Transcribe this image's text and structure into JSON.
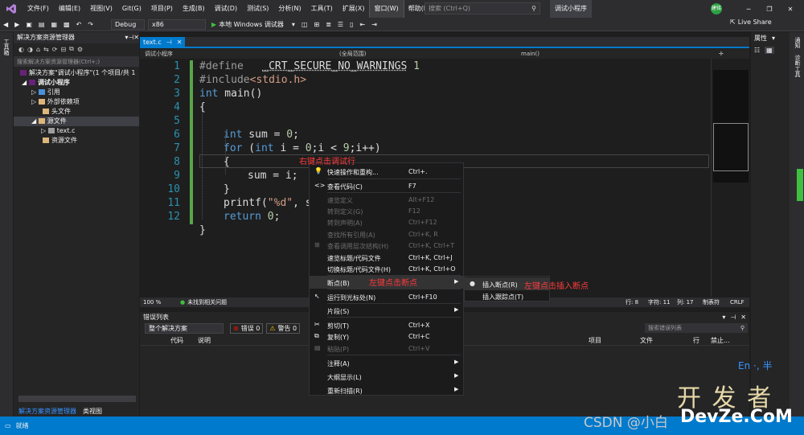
{
  "menu": {
    "items": [
      "文件(F)",
      "编辑(E)",
      "视图(V)",
      "Git(G)",
      "项目(P)",
      "生成(B)",
      "调试(D)",
      "测试(S)",
      "分析(N)",
      "工具(T)",
      "扩展(X)",
      "窗口(W)",
      "帮助(H)"
    ],
    "search_placeholder": "搜索 (Ctrl+Q)",
    "project_title": "调试小程序",
    "avatar_initials": "建铭",
    "live_share": "Live Share"
  },
  "toolbar": {
    "config": "Debug",
    "platform": "x86",
    "run_label": "本地 Windows 调试器"
  },
  "solution_explorer": {
    "title": "解决方案资源管理器",
    "search_placeholder": "搜索解决方案资源管理器(Ctrl+;)",
    "items": [
      {
        "label": "解决方案\"调试小程序\"(1 个项目/共 1"
      },
      {
        "label": "调试小程序"
      },
      {
        "label": "引用"
      },
      {
        "label": "外部依赖项"
      },
      {
        "label": "头文件"
      },
      {
        "label": "源文件"
      },
      {
        "label": "text.c"
      },
      {
        "label": "资源文件"
      }
    ],
    "bottom_tabs": [
      "解决方案资源管理器",
      "类视图"
    ]
  },
  "left_strip": {
    "toolbox": "工具箱"
  },
  "editor": {
    "tab": "text.c",
    "nav_project": "调试小程序",
    "nav_scope": "(全局范围)",
    "nav_member": "main()",
    "zoom": "100 %",
    "no_issues": "未找到相关问题",
    "pos_line": "行: 8",
    "pos_char": "字符: 11",
    "pos_col": "列: 17",
    "pos_tab": "制表符",
    "pos_eol": "CRLF",
    "annotation": "右键点击调试行",
    "line_numbers": [
      "1",
      "2",
      "3",
      "4",
      "5",
      "6",
      "7",
      "8",
      "9",
      "10",
      "11",
      "12"
    ],
    "lines": {
      "l1a": "#define",
      "l1b": "_CRT_SECURE_NO_WARNINGS",
      "l1c": "1",
      "l2a": "#include",
      "l2b": "<stdio.h>",
      "l3a": "int",
      "l3b": " main()",
      "l4": "{",
      "l6a": "int",
      "l6b": " sum = ",
      "l6c": "0",
      "l6d": ";",
      "l7a": "for",
      "l7b": " (",
      "l7c": "int",
      "l7d": " i = ",
      "l7e": "0",
      "l7f": ";i < ",
      "l7g": "9",
      "l7h": ";i++)",
      "l8": "{",
      "l9": "sum = i;",
      "l10": "}",
      "l11a": "printf(",
      "l11b": "\"%d\"",
      "l11c": ", su",
      "l12a": "return",
      "l12b": " ",
      "l12c": "0",
      "l12d": ";",
      "l13": "}"
    }
  },
  "context_menu": {
    "items": [
      {
        "label": "快速操作和重构...",
        "shortcut": "Ctrl+."
      },
      {
        "label": "查看代码(C)",
        "shortcut": "F7"
      },
      {
        "label": "速览定义",
        "shortcut": "Alt+F12"
      },
      {
        "label": "转到定义(G)",
        "shortcut": "F12"
      },
      {
        "label": "转到声明(A)",
        "shortcut": "Ctrl+F12"
      },
      {
        "label": "查找所有引用(A)",
        "shortcut": "Ctrl+K, R"
      },
      {
        "label": "查看调用层次结构(H)",
        "shortcut": "Ctrl+K, Ctrl+T"
      },
      {
        "label": "速览标题/代码文件",
        "shortcut": "Ctrl+K, Ctrl+J"
      },
      {
        "label": "切换标题/代码文件(H)",
        "shortcut": "Ctrl+K, Ctrl+O"
      },
      {
        "label": "断点(B)",
        "shortcut": ""
      },
      {
        "label": "运行到光标处(N)",
        "shortcut": "Ctrl+F10"
      },
      {
        "label": "片段(S)",
        "shortcut": ""
      },
      {
        "label": "剪切(T)",
        "shortcut": "Ctrl+X"
      },
      {
        "label": "复制(Y)",
        "shortcut": "Ctrl+C"
      },
      {
        "label": "粘贴(P)",
        "shortcut": "Ctrl+V"
      },
      {
        "label": "注释(A)",
        "shortcut": ""
      },
      {
        "label": "大纲显示(L)",
        "shortcut": ""
      },
      {
        "label": "重新扫描(R)",
        "shortcut": ""
      }
    ],
    "annotation_breakpoint": "左键点击断点"
  },
  "submenu": {
    "items": [
      "插入断点(R)",
      "插入跟踪点(T)"
    ],
    "annotation": "左键点击插入断点"
  },
  "error_list": {
    "title": "错误列表",
    "scope": "整个解决方案",
    "errors": "错误 0",
    "warnings": "警告 0",
    "search_placeholder": "搜索错误列表",
    "columns": [
      "代码",
      "说明",
      "项目",
      "文件",
      "行",
      "禁止..."
    ]
  },
  "right_panel": {
    "properties": "属性",
    "side_tabs": [
      "通知",
      "诊断工具"
    ]
  },
  "ime": "En ·, 半",
  "status": {
    "ready": "就绪",
    "watermark_csdn": "CSDN @小白",
    "watermark_site": "DevZe.CoM",
    "watermark_cn": "开 发 者"
  }
}
